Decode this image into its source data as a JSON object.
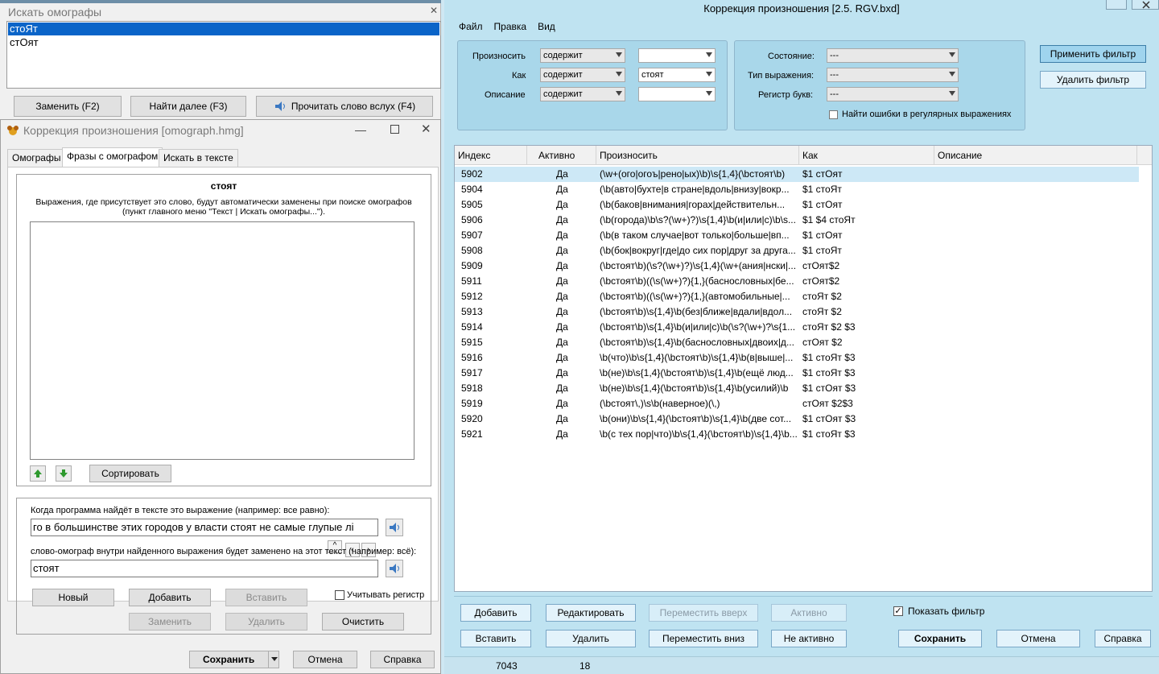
{
  "main": {
    "title": "Коррекция произношения [2.5. RGV.bxd]",
    "menu": [
      "Файл",
      "Правка",
      "Вид"
    ],
    "filter": {
      "pronounce_label": "Произносить",
      "how_label": "Как",
      "desc_label": "Описание",
      "pronounce_mode": "содержит",
      "how_mode": "содержит",
      "desc_mode": "содержит",
      "pronounce_value": "",
      "how_value": "стоят",
      "desc_value": "",
      "state_label": "Состояние:",
      "expr_type_label": "Тип выражения:",
      "case_label": "Регистр букв:",
      "state_value": "---",
      "expr_type_value": "---",
      "case_value": "---",
      "regex_errors_label": "Найти ошибки в регулярных выражениях",
      "apply_button": "Применить фильтр",
      "remove_button": "Удалить фильтр"
    },
    "columns": [
      "Индекс",
      "Активно",
      "Произносить",
      "Как",
      "Описание"
    ],
    "rows": [
      {
        "index": "5902",
        "active": "Да",
        "pronounce": "(\\w+(ого|огоъ|рено|ых)\\b)\\s{1,4}(\\bстоят\\b)",
        "how": "$1 стОят",
        "desc": ""
      },
      {
        "index": "5904",
        "active": "Да",
        "pronounce": "(\\b(авто|бухте|в стране|вдоль|внизу|вокр...",
        "how": "$1 стоЯт",
        "desc": ""
      },
      {
        "index": "5905",
        "active": "Да",
        "pronounce": "(\\b(баков|внимания|горах|действительн...",
        "how": "$1 стОят",
        "desc": ""
      },
      {
        "index": "5906",
        "active": "Да",
        "pronounce": "(\\b(города)\\b\\s?(\\w+)?)\\s{1,4}\\b(и|или|с)\\b\\s...",
        "how": "$1 $4 стоЯт",
        "desc": ""
      },
      {
        "index": "5907",
        "active": "Да",
        "pronounce": "(\\b(в таком случае|вот только|больше|вп...",
        "how": "$1 стОят",
        "desc": ""
      },
      {
        "index": "5908",
        "active": "Да",
        "pronounce": "(\\b(бок|вокруг|где|до сих пор|друг за друга...",
        "how": "$1 стоЯт",
        "desc": ""
      },
      {
        "index": "5909",
        "active": "Да",
        "pronounce": "(\\bстоят\\b)(\\s?(\\w+)?)\\s{1,4}(\\w+(ания|нски|...",
        "how": "стОят$2",
        "desc": ""
      },
      {
        "index": "5911",
        "active": "Да",
        "pronounce": "(\\bстоят\\b)((\\s(\\w+)?){1,}(баснословных|бе...",
        "how": "стОят$2",
        "desc": ""
      },
      {
        "index": "5912",
        "active": "Да",
        "pronounce": "(\\bстоят\\b)((\\s(\\w+)?){1,}(автомобильные|...",
        "how": "стоЯт $2",
        "desc": ""
      },
      {
        "index": "5913",
        "active": "Да",
        "pronounce": "(\\bстоят\\b)\\s{1,4}\\b(без|ближе|вдали|вдол...",
        "how": "стоЯт $2",
        "desc": ""
      },
      {
        "index": "5914",
        "active": "Да",
        "pronounce": "(\\bстоят\\b)\\s{1,4}\\b(и|или|с)\\b(\\s?(\\w+)?\\s{1...",
        "how": "стоЯт $2 $3",
        "desc": ""
      },
      {
        "index": "5915",
        "active": "Да",
        "pronounce": "(\\bстоят\\b)\\s{1,4}\\b(баснословных|двоих|д...",
        "how": "стОят $2",
        "desc": ""
      },
      {
        "index": "5916",
        "active": "Да",
        "pronounce": "\\b(что)\\b\\s{1,4}(\\bстоят\\b)\\s{1,4}\\b(в|выше|...",
        "how": "$1 стоЯт $3",
        "desc": ""
      },
      {
        "index": "5917",
        "active": "Да",
        "pronounce": "\\b(не)\\b\\s{1,4}(\\bстоят\\b)\\s{1,4}\\b(ещё люд...",
        "how": "$1 стоЯт $3",
        "desc": ""
      },
      {
        "index": "5918",
        "active": "Да",
        "pronounce": "\\b(не)\\b\\s{1,4}(\\bстоят\\b)\\s{1,4}\\b(усилий)\\b",
        "how": "$1 стОят $3",
        "desc": ""
      },
      {
        "index": "5919",
        "active": "Да",
        "pronounce": "(\\bстоят\\,)\\s\\b(наверное)(\\,)",
        "how": "стОят $2$3",
        "desc": ""
      },
      {
        "index": "5920",
        "active": "Да",
        "pronounce": "\\b(они)\\b\\s{1,4}(\\bстоят\\b)\\s{1,4}\\b(две сот...",
        "how": "$1 стОят $3",
        "desc": ""
      },
      {
        "index": "5921",
        "active": "Да",
        "pronounce": "\\b(с тех пор|что)\\b\\s{1,4}(\\bстоят\\b)\\s{1,4}\\b...",
        "how": "$1 стоЯт $3",
        "desc": ""
      }
    ],
    "buttons": {
      "add": "Добавить",
      "edit": "Редактировать",
      "move_up": "Переместить вверх",
      "active": "Активно",
      "paste": "Вставить",
      "delete": "Удалить",
      "move_down": "Переместить вниз",
      "inactive": "Не активно",
      "save": "Сохранить",
      "cancel": "Отмена",
      "help": "Справка"
    },
    "show_filter_label": "Показать фильтр",
    "show_filter_checked": true,
    "status": {
      "total": "7043",
      "count": "18"
    }
  },
  "omograph_window": {
    "title": "Искать омографы",
    "items": [
      "стоЯт",
      "стОят"
    ],
    "replace_button": "Заменить (F2)",
    "find_next_button": "Найти далее (F3)",
    "read_aloud_button": "Прочитать слово вслух (F4)"
  },
  "dialog": {
    "title": "Коррекция произношения [omograph.hmg]",
    "tabs": [
      "Омографы",
      "Фразы с омографом",
      "Искать в тексте"
    ],
    "active_tab": 1,
    "word": "стоят",
    "description_line1": "Выражения, где присутствует это слово, будут автоматически заменены при поиске омографов",
    "description_line2": "(пункт главного меню \"Текст | Искать омографы...\").",
    "sort_button": "Сортировать",
    "when_found_label": "Когда программа найдёт в тексте это выражение (например: все равно):",
    "phrase_value": "го в большинстве этих городов у власти стоят не самые глупые лі",
    "replace_label": "слово-омограф внутри найденного выражения будет заменено на этот текст (например: всё):",
    "replace_value": "стоят",
    "new_button": "Новый",
    "add_button": "Добавить",
    "paste_button": "Вставить",
    "replace_button": "Заменить",
    "delete_button": "Удалить",
    "clear_button": "Очистить",
    "case_checkbox_label": "Учитывать регистр",
    "save_button": "Сохранить",
    "cancel_button": "Отмена",
    "help_button": "Справка"
  }
}
